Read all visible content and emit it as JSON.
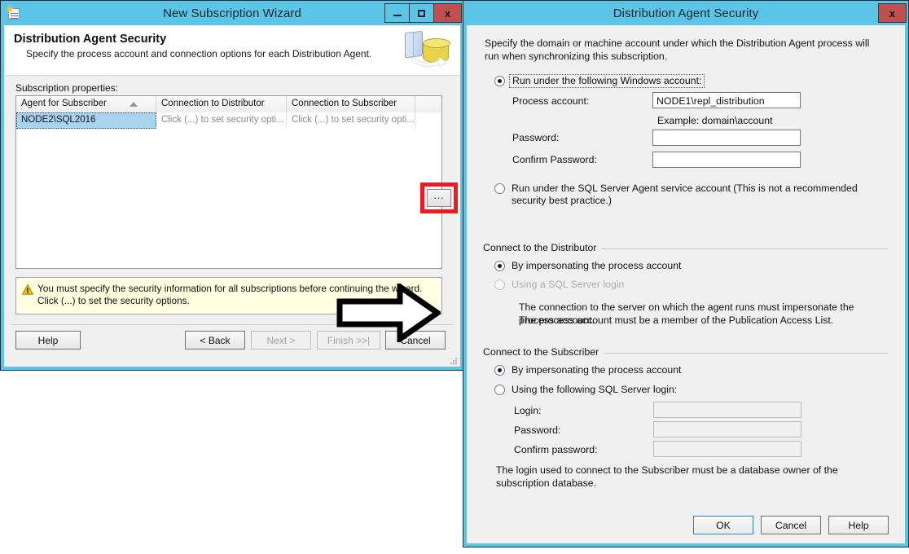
{
  "wizard": {
    "title": "New Subscription Wizard",
    "app_icon": "subscription-wizard-icon",
    "window_buttons": {
      "minimize": "–",
      "maximize": "□",
      "close": "x"
    },
    "banner": {
      "heading": "Distribution Agent Security",
      "subheading": "Specify the process account and connection options for each Distribution Agent.",
      "art": "book-and-database-icon"
    },
    "grid_label": "Subscription properties:",
    "grid": {
      "columns": [
        "Agent for Subscriber",
        "Connection to Distributor",
        "Connection to Subscriber",
        ""
      ],
      "sorted_column": "Agent for Subscriber",
      "sort_direction": "ascending",
      "rows": [
        {
          "agent_for_subscriber": "NODE2\\SQL2016",
          "connection_to_distributor": "Click (...) to set security opti...",
          "connection_to_subscriber": "Click (...) to set security opti...",
          "action": "..."
        }
      ]
    },
    "ellipsis_button": "...",
    "warning": "You must specify the security information for all subscriptions before continuing the wizard. Click (...) to set the security options.",
    "buttons": {
      "help": "Help",
      "back": "< Back",
      "next": "Next >",
      "finish": "Finish >>|",
      "cancel": "Cancel"
    },
    "annotation_arrow": "right-arrow-annotation",
    "highlight": "red-highlight-box"
  },
  "dialog": {
    "title": "Distribution Agent Security",
    "close_label": "x",
    "intro": "Specify the domain or machine account under which the Distribution Agent process will run when synchronizing this subscription.",
    "process_account_section": {
      "windows_account_radio": "Run under the following Windows account:",
      "windows_account_selected": true,
      "process_account_label": "Process account:",
      "process_account_value": "NODE1\\repl_distribution",
      "process_account_example": "Example: domain\\account",
      "password_label": "Password:",
      "password_value": "",
      "confirm_password_label": "Confirm Password:",
      "confirm_password_value": "",
      "agent_service_radio": "Run under the SQL Server Agent service account (This is not a recommended security best practice.)",
      "agent_service_selected": false
    },
    "distributor_section": {
      "caption": "Connect to the Distributor",
      "impersonate_radio": "By impersonating the process account",
      "impersonate_selected": true,
      "sql_login_radio": "Using a SQL Server login",
      "sql_login_selected": false,
      "sql_login_disabled": true,
      "description_line1": "The connection to the server on which the agent runs must impersonate the process account.",
      "description_line2": "The process account must be a member of the Publication Access List."
    },
    "subscriber_section": {
      "caption": "Connect to the Subscriber",
      "impersonate_radio": "By impersonating the process account",
      "impersonate_selected": true,
      "sql_login_radio": "Using the following SQL Server login:",
      "sql_login_selected": false,
      "login_label": "Login:",
      "login_value": "",
      "password_label": "Password:",
      "password_value": "",
      "confirm_password_label": "Confirm password:",
      "confirm_password_value": "",
      "description": "The login used to connect to the Subscriber must be a database owner of the subscription database."
    },
    "buttons": {
      "ok": "OK",
      "cancel": "Cancel",
      "help": "Help"
    }
  },
  "colors": {
    "titlebar": "#5bc5e7",
    "close_button": "#c0504d",
    "dialog_face": "#f0f0f0",
    "warning_background": "#ffffe1",
    "selection": "#a8d4f0",
    "highlight_red": "#ec1c24",
    "default_button_border": "#2a7fc4"
  }
}
